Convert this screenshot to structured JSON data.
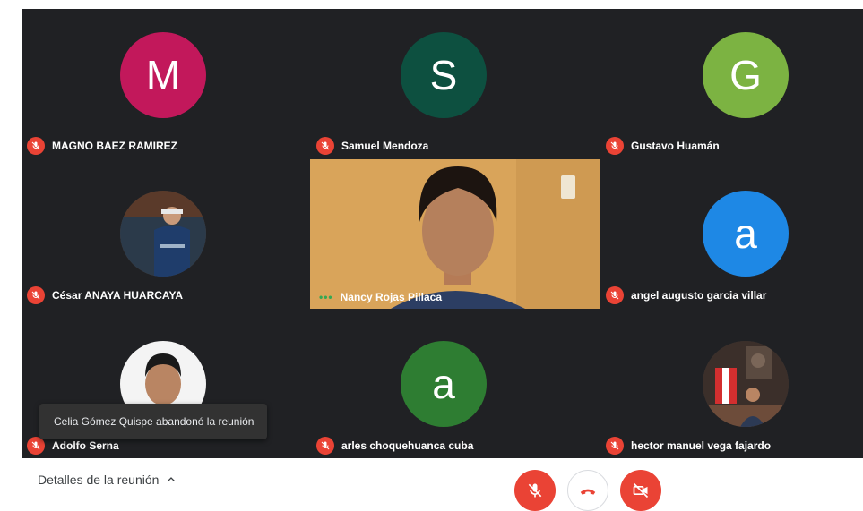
{
  "participants": [
    {
      "name": "MAGNO BAEZ RAMIREZ",
      "initial": "M",
      "color": "#c2185b"
    },
    {
      "name": "Samuel Mendoza",
      "initial": "S",
      "color": "#0d5040"
    },
    {
      "name": "Gustavo Huamán",
      "initial": "G",
      "color": "#7cb342"
    },
    {
      "name": "César ANAYA HUARCAYA"
    },
    {
      "name": "Nancy Rojas Pillaca"
    },
    {
      "name": "angel augusto garcia villar",
      "initial": "a",
      "color": "#1e88e5"
    },
    {
      "name": "Adolfo Serna"
    },
    {
      "name": "arles choquehuanca cuba",
      "initial": "a",
      "color": "#2e7d32"
    },
    {
      "name": "hector manuel vega fajardo"
    }
  ],
  "toast": "Celia Gómez Quispe abandonó la reunión",
  "footer": {
    "details_label": "Detalles de la reunión"
  },
  "colors": {
    "stage": "#202124",
    "muted_red": "#ea4335"
  }
}
